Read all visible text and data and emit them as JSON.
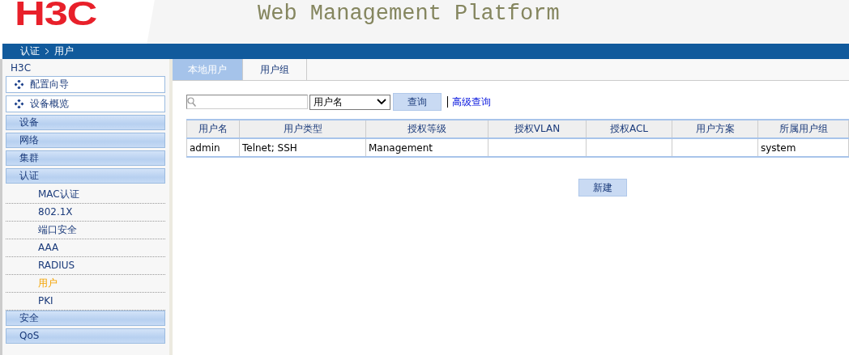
{
  "header": {
    "logo": "H3C",
    "title": "Web Management Platform"
  },
  "breadcrumb": [
    "认证",
    "用户"
  ],
  "sidebar": {
    "title": "H3C",
    "items": [
      {
        "kind": "wizard",
        "label": "配置向导"
      },
      {
        "kind": "wizard",
        "label": "设备概览"
      },
      {
        "kind": "category",
        "label": "设备"
      },
      {
        "kind": "category",
        "label": "网络"
      },
      {
        "kind": "category",
        "label": "集群"
      },
      {
        "kind": "category",
        "label": "认证",
        "children": [
          {
            "label": "MAC认证",
            "selected": false
          },
          {
            "label": "802.1X",
            "selected": false
          },
          {
            "label": "端口安全",
            "selected": false
          },
          {
            "label": "AAA",
            "selected": false
          },
          {
            "label": "RADIUS",
            "selected": false
          },
          {
            "label": "用户",
            "selected": true
          },
          {
            "label": "PKI",
            "selected": false
          }
        ]
      },
      {
        "kind": "category",
        "label": "安全"
      },
      {
        "kind": "category",
        "label": "QoS"
      }
    ]
  },
  "tabs": [
    {
      "label": "本地用户",
      "selected": true
    },
    {
      "label": "用户组",
      "selected": false
    }
  ],
  "search": {
    "field_select": "用户名",
    "button": "查询",
    "advanced_link": "高级查询"
  },
  "table": {
    "columns": [
      "用户名",
      "用户类型",
      "授权等级",
      "授权VLAN",
      "授权ACL",
      "用户方案",
      "所属用户组"
    ],
    "rows": [
      [
        "admin",
        "Telnet; SSH",
        "Management",
        "",
        "",
        "",
        "system"
      ]
    ]
  },
  "new_button": "新建"
}
